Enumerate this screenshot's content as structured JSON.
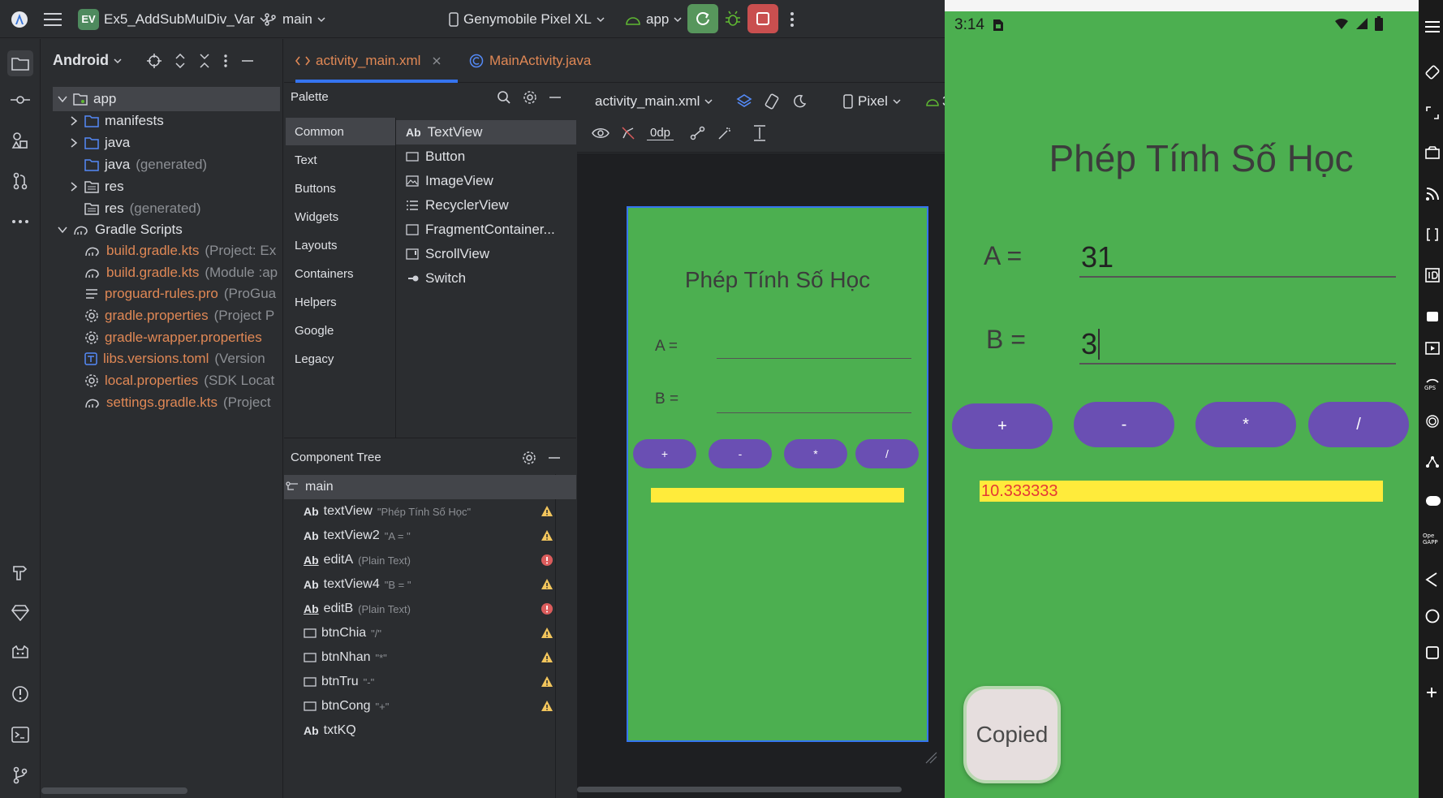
{
  "titlebar": {
    "project_badge": "EV",
    "project_name": "Ex5_AddSubMulDiv_Var",
    "branch": "main",
    "device": "Genymobile Pixel XL",
    "run_config": "app"
  },
  "project_panel": {
    "view_mode": "Android",
    "items": [
      {
        "label": "app",
        "hint": ""
      },
      {
        "label": "manifests",
        "hint": ""
      },
      {
        "label": "java",
        "hint": ""
      },
      {
        "label": "java",
        "hint": "(generated)"
      },
      {
        "label": "res",
        "hint": ""
      },
      {
        "label": "res",
        "hint": "(generated)"
      },
      {
        "label": "Gradle Scripts",
        "hint": ""
      },
      {
        "label": "build.gradle.kts",
        "hint": "(Project: Ex"
      },
      {
        "label": "build.gradle.kts",
        "hint": "(Module :ap"
      },
      {
        "label": "proguard-rules.pro",
        "hint": "(ProGua"
      },
      {
        "label": "gradle.properties",
        "hint": "(Project P"
      },
      {
        "label": "gradle-wrapper.properties",
        "hint": ""
      },
      {
        "label": "libs.versions.toml",
        "hint": "(Version"
      },
      {
        "label": "local.properties",
        "hint": "(SDK Locat"
      },
      {
        "label": "settings.gradle.kts",
        "hint": "(Project"
      }
    ]
  },
  "editor_tabs": [
    {
      "label": "activity_main.xml"
    },
    {
      "label": "MainActivity.java"
    }
  ],
  "palette": {
    "title": "Palette",
    "categories": [
      "Common",
      "Text",
      "Buttons",
      "Widgets",
      "Layouts",
      "Containers",
      "Helpers",
      "Google",
      "Legacy"
    ],
    "items": [
      "TextView",
      "Button",
      "ImageView",
      "RecyclerView",
      "FragmentContainer...",
      "ScrollView",
      "Switch"
    ]
  },
  "component_tree": {
    "title": "Component Tree",
    "root": "main",
    "rows": [
      {
        "name": "textView",
        "hint": "\"Phép Tính Số Học\"",
        "status": "warn"
      },
      {
        "name": "textView2",
        "hint": "\"A = \"",
        "status": "warn"
      },
      {
        "name": "editA",
        "hint": "(Plain Text)",
        "status": "error"
      },
      {
        "name": "textView4",
        "hint": "\"B = \"",
        "status": "warn"
      },
      {
        "name": "editB",
        "hint": "(Plain Text)",
        "status": "error"
      },
      {
        "name": "btnChia",
        "hint": "\"/\"",
        "status": "warn"
      },
      {
        "name": "btnNhan",
        "hint": "\"*\"",
        "status": "warn"
      },
      {
        "name": "btnTru",
        "hint": "\"-\"",
        "status": "warn"
      },
      {
        "name": "btnCong",
        "hint": "\"+\"",
        "status": "warn"
      },
      {
        "name": "txtKQ",
        "hint": "",
        "status": "none"
      }
    ]
  },
  "design_toolbar": {
    "file": "activity_main.xml",
    "device": "Pixel",
    "api_level": "3",
    "margin": "0dp"
  },
  "preview": {
    "title": "Phép Tính Số Học",
    "label_a": "A =",
    "label_b": "B =",
    "buttons": [
      "+",
      "-",
      "*",
      "/"
    ]
  },
  "emulator": {
    "time": "3:14",
    "title": "Phép Tính Số Học",
    "label_a": "A =",
    "value_a": "31",
    "label_b": "B =",
    "value_b": "3",
    "buttons": [
      "+",
      "-",
      "*",
      "/"
    ],
    "result": "10.333333",
    "toast": "Copied"
  },
  "colors": {
    "app_green": "#4caf50",
    "button_purple": "#6a4fb3",
    "result_yellow": "#ffeb3b",
    "result_text": "#e53935"
  }
}
